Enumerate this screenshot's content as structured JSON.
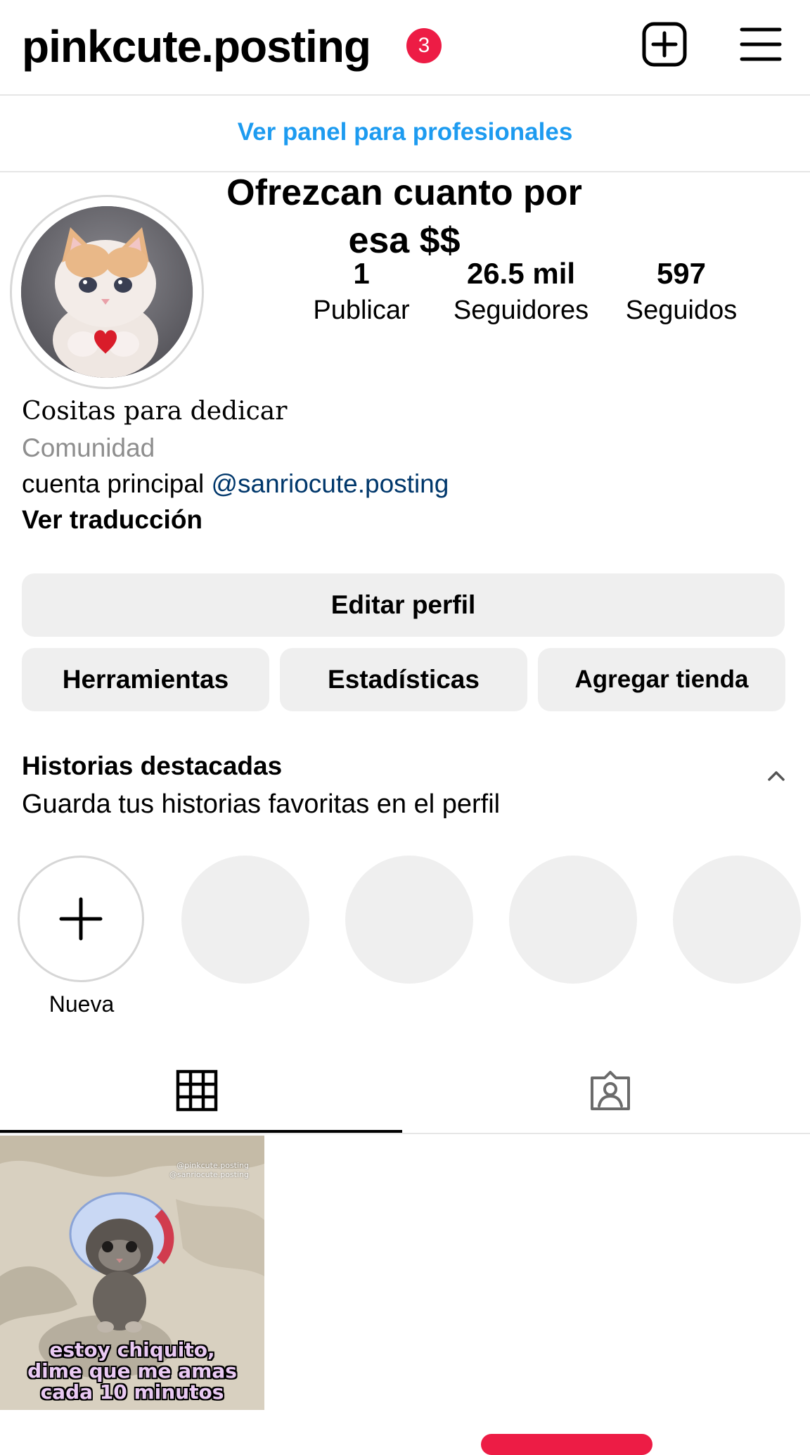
{
  "header": {
    "username": "pinkcute.posting",
    "notification_count": "3",
    "create_icon": "plus-square-icon",
    "menu_icon": "hamburger-menu-icon"
  },
  "professional_dashboard_link": "Ver panel para profesionales",
  "profile": {
    "display_name_line1": "Ofrezcan cuanto por",
    "display_name_line2": "esa $$",
    "stats": [
      {
        "value": "1",
        "label": "Publicar"
      },
      {
        "value": "26.5 mil",
        "label": "Seguidores"
      },
      {
        "value": "597",
        "label": "Seguidos"
      }
    ],
    "bio": {
      "line1": "Cositas para dedicar",
      "category": "Comunidad",
      "line3_text": "cuenta principal ",
      "mention": "@sanriocute.posting",
      "translate": "Ver traducción"
    }
  },
  "buttons": {
    "edit_profile": "Editar perfil",
    "tools": "Herramientas",
    "insights": "Estadísticas",
    "add_shop": "Agregar tienda"
  },
  "highlights": {
    "title": "Historias destacadas",
    "subtitle": "Guarda tus historias favoritas en el perfil",
    "new_label": "Nueva"
  },
  "tabs": [
    "grid-icon",
    "tagged-icon"
  ],
  "post": {
    "watermark_line1": "@pinkcute.posting",
    "watermark_line2": "@sanriocute.posting",
    "caption_line1": "estoy chiquito,",
    "caption_line2": "dime que me amas",
    "caption_line3": "cada 10 minutos"
  },
  "colors": {
    "link_blue": "#1d9bf0",
    "mention_blue": "#00376b",
    "badge_red": "#ed1c45",
    "button_gray": "#efefef"
  }
}
